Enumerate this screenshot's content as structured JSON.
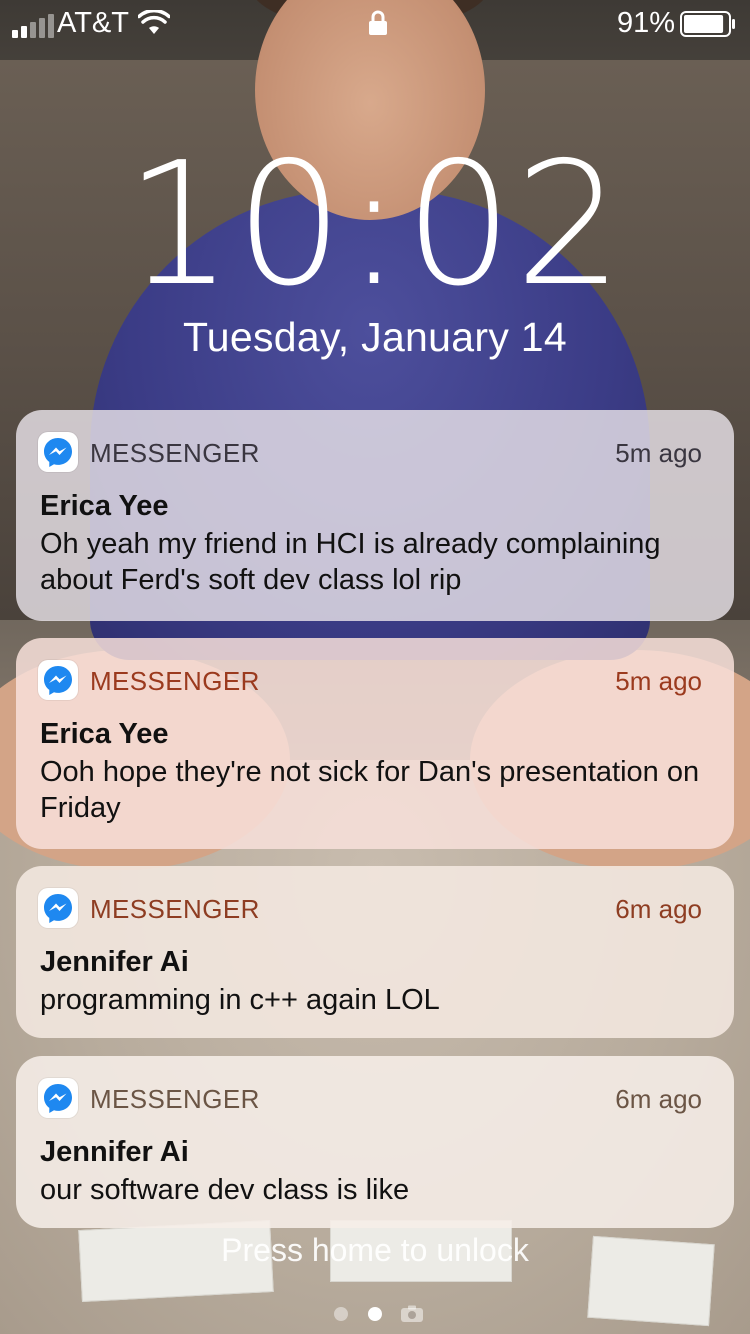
{
  "status_bar": {
    "carrier": "AT&T",
    "battery_percent": "91%",
    "battery_level": 0.91,
    "signal_bars": 2,
    "icons": [
      "signal-icon",
      "wifi-icon",
      "lock-icon",
      "battery-icon"
    ]
  },
  "lock_screen": {
    "time": "10:02",
    "date": "Tuesday, January 14",
    "unlock_hint": "Press home to unlock"
  },
  "notifications": [
    {
      "app": "MESSENGER",
      "app_icon": "messenger-icon",
      "time": "5m ago",
      "sender": "Erica Yee",
      "message": "Oh yeah my friend in HCI is already complaining about Ferd's soft dev class lol rip"
    },
    {
      "app": "MESSENGER",
      "app_icon": "messenger-icon",
      "time": "5m ago",
      "sender": "Erica Yee",
      "message": "Ooh hope they're not sick for Dan's presentation on Friday"
    },
    {
      "app": "MESSENGER",
      "app_icon": "messenger-icon",
      "time": "6m ago",
      "sender": "Jennifer Ai",
      "message": "programming in c++ again LOL"
    },
    {
      "app": "MESSENGER",
      "app_icon": "messenger-icon",
      "time": "6m ago",
      "sender": "Jennifer Ai",
      "message": "our software dev class is like"
    }
  ],
  "page_indicator": {
    "pages": 3,
    "active_page": 2,
    "last_page_icon": "camera-icon"
  },
  "colors": {
    "messenger_blue": "#1e88f0"
  }
}
